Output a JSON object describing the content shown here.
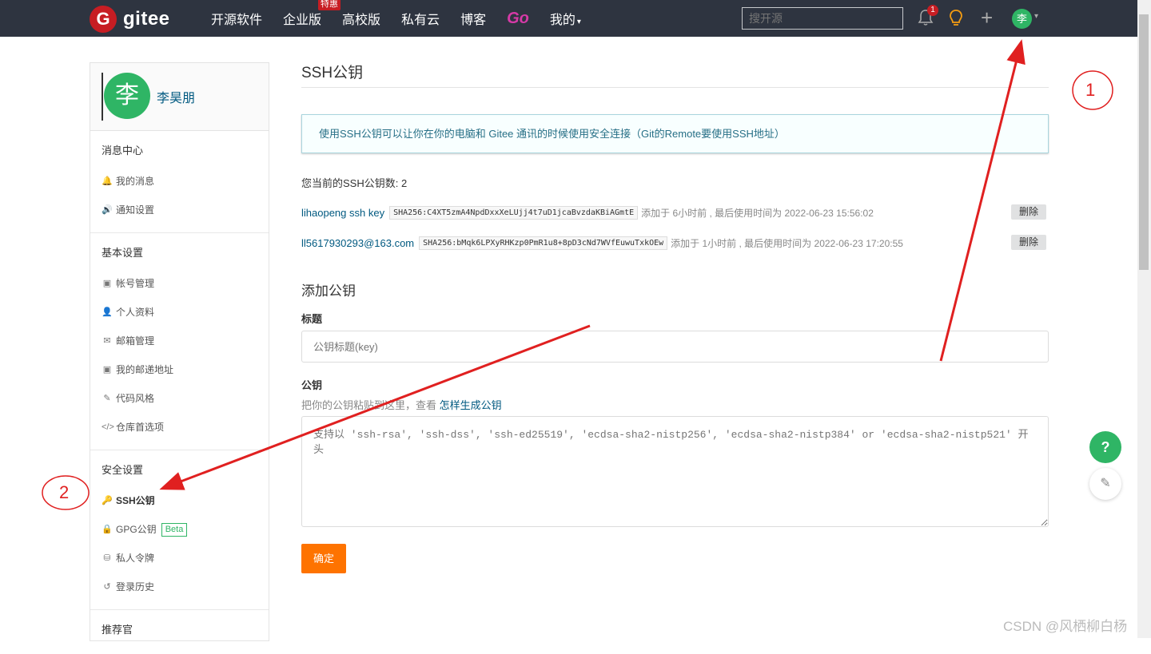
{
  "topbar": {
    "logo_text": "gitee",
    "logo_mark": "G",
    "nav": [
      {
        "label": "开源软件"
      },
      {
        "label": "企业版",
        "badge": "特惠"
      },
      {
        "label": "高校版"
      },
      {
        "label": "私有云"
      },
      {
        "label": "博客"
      },
      {
        "label": "Go"
      },
      {
        "label": "我的",
        "caret": "▾"
      }
    ],
    "search_placeholder": "搜开源",
    "notification_count": "1",
    "plus": "+",
    "user_avatar": "李",
    "user_caret": "▾",
    "icons": [
      "bell-icon",
      "bulb-icon",
      "plus-icon"
    ]
  },
  "sidebar": {
    "avatar": "李",
    "username": "李昊朋",
    "sections": [
      {
        "title": "消息中心",
        "items": [
          {
            "icon": "bell",
            "glyph": "🔔",
            "label": "我的消息"
          },
          {
            "icon": "speaker",
            "glyph": "🔊",
            "label": "通知设置"
          }
        ]
      },
      {
        "title": "基本设置",
        "items": [
          {
            "icon": "id-card",
            "glyph": "▣",
            "label": "帐号管理"
          },
          {
            "icon": "user",
            "glyph": "👤",
            "label": "个人资料"
          },
          {
            "icon": "mail",
            "glyph": "✉",
            "label": "邮箱管理"
          },
          {
            "icon": "address-card",
            "glyph": "▣",
            "label": "我的邮递地址"
          },
          {
            "icon": "brush",
            "glyph": "✎",
            "label": "代码风格"
          },
          {
            "icon": "code",
            "glyph": "</>",
            "label": "仓库首选项"
          }
        ]
      },
      {
        "title": "安全设置",
        "items": [
          {
            "icon": "key",
            "glyph": "🔑",
            "label": "SSH公钥",
            "active": true
          },
          {
            "icon": "lock",
            "glyph": "🔒",
            "label": "GPG公钥",
            "badge": "Beta"
          },
          {
            "icon": "token",
            "glyph": "⛁",
            "label": "私人令牌"
          },
          {
            "icon": "history",
            "glyph": "↺",
            "label": "登录历史"
          }
        ]
      },
      {
        "title": "推荐官",
        "items": []
      }
    ]
  },
  "main": {
    "title": "SSH公钥",
    "info": "使用SSH公钥可以让你在你的电脑和 Gitee 通讯的时候使用安全连接（Git的Remote要使用SSH地址）",
    "count_text": "您当前的SSH公钥数: 2",
    "keys": [
      {
        "name": "lihaopeng ssh key",
        "fingerprint": "SHA256:C4XT5zmA4NpdDxxXeLUjj4t7uD1jcaBvzdaKBiAGmtE",
        "meta": "添加于 6小时前 , 最后使用时间为 2022-06-23 15:56:02",
        "delete": "删除"
      },
      {
        "name": "ll5617930293@163.com",
        "fingerprint": "SHA256:bMqk6LPXyRHKzp0PmR1u8+8pD3cNd7WVfEuwuTxkOEw",
        "meta": "添加于 1小时前 , 最后使用时间为 2022-06-23 17:20:55",
        "delete": "删除"
      }
    ],
    "add_title": "添加公钥",
    "title_label": "标题",
    "title_placeholder": "公钥标题(key)",
    "key_label": "公钥",
    "key_hint": "把你的公钥粘贴到这里，查看",
    "key_hint_link": "怎样生成公钥",
    "key_placeholder": "支持以 'ssh-rsa', 'ssh-dss', 'ssh-ed25519', 'ecdsa-sha2-nistp256', 'ecdsa-sha2-nistp384' or 'ecdsa-sha2-nistp521' 开头",
    "confirm": "确定"
  },
  "floating": {
    "help": "?",
    "edit": "✎"
  },
  "annotations": {
    "label1": "1",
    "label2": "2",
    "arrow_color": "#e02020"
  },
  "watermark": "CSDN @风栖柳白杨",
  "colors": {
    "brand_green": "#2fb565",
    "brand_red": "#c71d23",
    "confirm_orange": "#fe7300",
    "link_blue": "#005980",
    "topbar": "#2e3440"
  }
}
